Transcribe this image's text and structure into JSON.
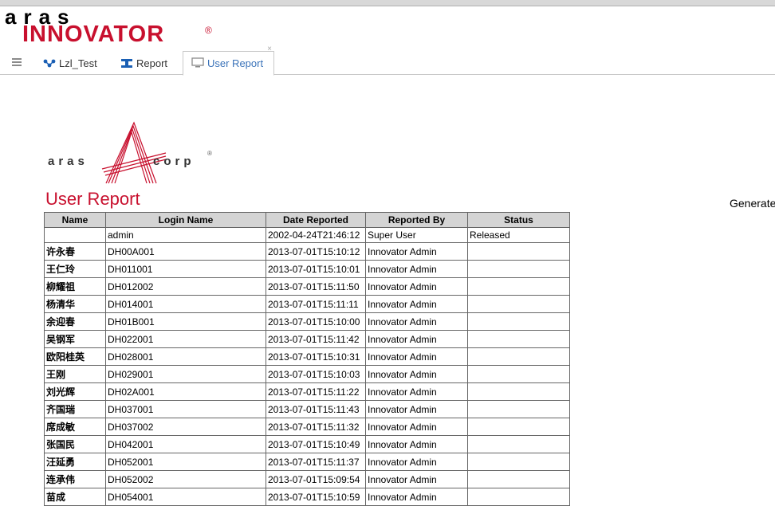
{
  "app": {
    "logo_top": "aras",
    "logo_main": "INNOVATOR",
    "logo_reg": "®"
  },
  "tabs": [
    {
      "label": "Lzl_Test",
      "icon": "workflow-icon"
    },
    {
      "label": "Report",
      "icon": "report-icon"
    },
    {
      "label": "User Report",
      "icon": "monitor-icon",
      "active": true,
      "close": "×"
    }
  ],
  "report": {
    "logo_aras": "aras",
    "logo_corp": "corp",
    "logo_reg": "®",
    "title": "User Report",
    "generated_label": "Generated",
    "columns": [
      "Name",
      "Login Name",
      "Date Reported",
      "Reported By",
      "Status"
    ],
    "rows": [
      [
        "",
        "admin",
        "2002-04-24T21:46:12",
        "Super User",
        "Released"
      ],
      [
        "许永春",
        "DH00A001",
        "2013-07-01T15:10:12",
        "Innovator Admin",
        ""
      ],
      [
        "王仁玲",
        "DH011001",
        "2013-07-01T15:10:01",
        "Innovator Admin",
        ""
      ],
      [
        "柳耀祖",
        "DH012002",
        "2013-07-01T15:11:50",
        "Innovator Admin",
        ""
      ],
      [
        "杨清华",
        "DH014001",
        "2013-07-01T15:11:11",
        "Innovator Admin",
        ""
      ],
      [
        "余迎春",
        "DH01B001",
        "2013-07-01T15:10:00",
        "Innovator Admin",
        ""
      ],
      [
        "吴钢军",
        "DH022001",
        "2013-07-01T15:11:42",
        "Innovator Admin",
        ""
      ],
      [
        "欧阳桂英",
        "DH028001",
        "2013-07-01T15:10:31",
        "Innovator Admin",
        ""
      ],
      [
        "王刚",
        "DH029001",
        "2013-07-01T15:10:03",
        "Innovator Admin",
        ""
      ],
      [
        "刘光辉",
        "DH02A001",
        "2013-07-01T15:11:22",
        "Innovator Admin",
        ""
      ],
      [
        "齐国瑞",
        "DH037001",
        "2013-07-01T15:11:43",
        "Innovator Admin",
        ""
      ],
      [
        "席成敏",
        "DH037002",
        "2013-07-01T15:11:32",
        "Innovator Admin",
        ""
      ],
      [
        "张国民",
        "DH042001",
        "2013-07-01T15:10:49",
        "Innovator Admin",
        ""
      ],
      [
        "汪延勇",
        "DH052001",
        "2013-07-01T15:11:37",
        "Innovator Admin",
        ""
      ],
      [
        "连承伟",
        "DH052002",
        "2013-07-01T15:09:54",
        "Innovator Admin",
        ""
      ],
      [
        "苗成",
        "DH054001",
        "2013-07-01T15:10:59",
        "Innovator Admin",
        ""
      ]
    ]
  },
  "colors": {
    "brand_red": "#c8102e",
    "tab_active": "#3b73b9",
    "header_gray": "#d4d4d4"
  }
}
